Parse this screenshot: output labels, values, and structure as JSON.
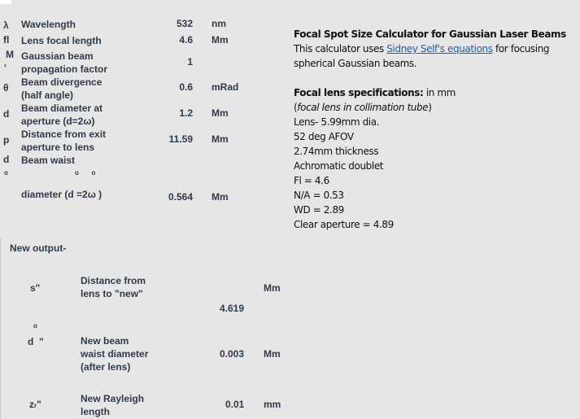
{
  "inputs": [
    {
      "symbol": "λ",
      "label": "Wavelength",
      "value": "532",
      "unit": "nm"
    },
    {
      "symbol": "fl",
      "label": "Lens focal length",
      "value": "4.6",
      "unit": "Mm"
    },
    {
      "symbol": "M",
      "symbol_sub": "²",
      "label_1": "Gaussian beam",
      "label_2": "propagation factor",
      "value": "1",
      "unit": ""
    },
    {
      "symbol": "θ",
      "label_1": "Beam divergence",
      "label_2": "(half angle)",
      "value": "0.6",
      "unit": "mRad"
    },
    {
      "symbol": "d",
      "label_1": "Beam diameter at",
      "label_2": "aperture (d=2ω)",
      "value": "1.2",
      "unit": "Mm"
    },
    {
      "symbol": "p",
      "label_1": "Distance from exit",
      "label_2": "aperture to lens",
      "value": "11.59",
      "unit": "Mm"
    },
    {
      "symbol": "d",
      "symbol_sub": "o",
      "label_1": "Beam waist",
      "label_2": "diameter (d  =2ω  )",
      "sub_marks": "o       o",
      "value": "0.564",
      "unit": "Mm"
    }
  ],
  "output": {
    "heading": "New output-",
    "rows": [
      {
        "symbol": "s\"",
        "label_1": "Distance from",
        "label_2": "lens to \"new\"",
        "value": "4.619",
        "unit": "Mm"
      },
      {
        "symbol": "d  \"",
        "symbol_sup": "o",
        "label_1": "New beam",
        "label_2": "waist diameter",
        "label_3": "(after lens)",
        "value": "0.003",
        "unit": "Mm"
      },
      {
        "symbol": "z",
        "symbol_sub": "r",
        "symbol_suffix": "\"",
        "label_1": "New Rayleigh",
        "label_2": "length",
        "value": "0.01",
        "unit": "mm"
      }
    ]
  },
  "info": {
    "title": "Focal Spot Size Calculator for Gaussian Laser Beams",
    "intro_pre": "This calculator uses ",
    "intro_link": "Sidney Self's equations",
    "intro_post": " for focusing",
    "intro_line2": "spherical Gaussian beams.",
    "specs_heading": "Focal lens specifications:",
    "specs_unit": " in mm",
    "specs_note": "focal lens in collimation tube",
    "specs": [
      "Lens- 5.99mm dia.",
      "52 deg AFOV",
      "2.74mm thickness",
      "Achromatic doublet",
      "Fl = 4.6",
      "N/A = 0.53",
      "WD = 2.89",
      "Clear aperture = 4.89"
    ],
    "link_color": "#1f5fbf"
  }
}
